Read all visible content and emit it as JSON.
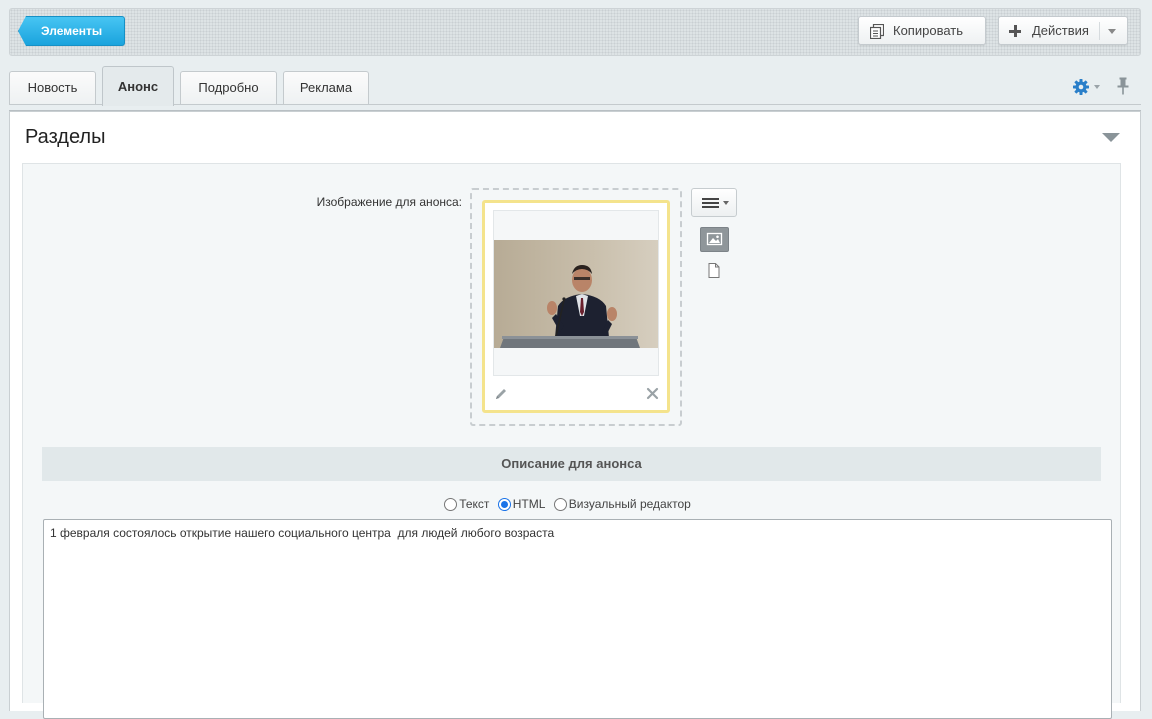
{
  "toolbar": {
    "elements_label": "Элементы",
    "copy_label": "Копировать",
    "actions_label": "Действия"
  },
  "tabs": [
    {
      "label": "Новость",
      "active": false
    },
    {
      "label": "Анонс",
      "active": true
    },
    {
      "label": "Подробно",
      "active": false
    },
    {
      "label": "Реклама",
      "active": false
    }
  ],
  "section": {
    "title": "Разделы"
  },
  "preview_image": {
    "label": "Изображение для анонса:",
    "icons": [
      "pencil-icon",
      "close-icon",
      "menu-icon",
      "image-icon",
      "file-icon"
    ]
  },
  "description": {
    "header": "Описание для анонса",
    "modes": [
      {
        "label": "Текст",
        "checked": false
      },
      {
        "label": "HTML",
        "checked": true
      },
      {
        "label": "Визуальный редактор",
        "checked": false
      }
    ],
    "text": "1 февраля состоялось открытие нашего социального центра  для людей любого возраста"
  },
  "colors": {
    "accent": "#1aa3dd",
    "card_border": "#f4e38c",
    "radio_checked": "#1a73e8"
  }
}
